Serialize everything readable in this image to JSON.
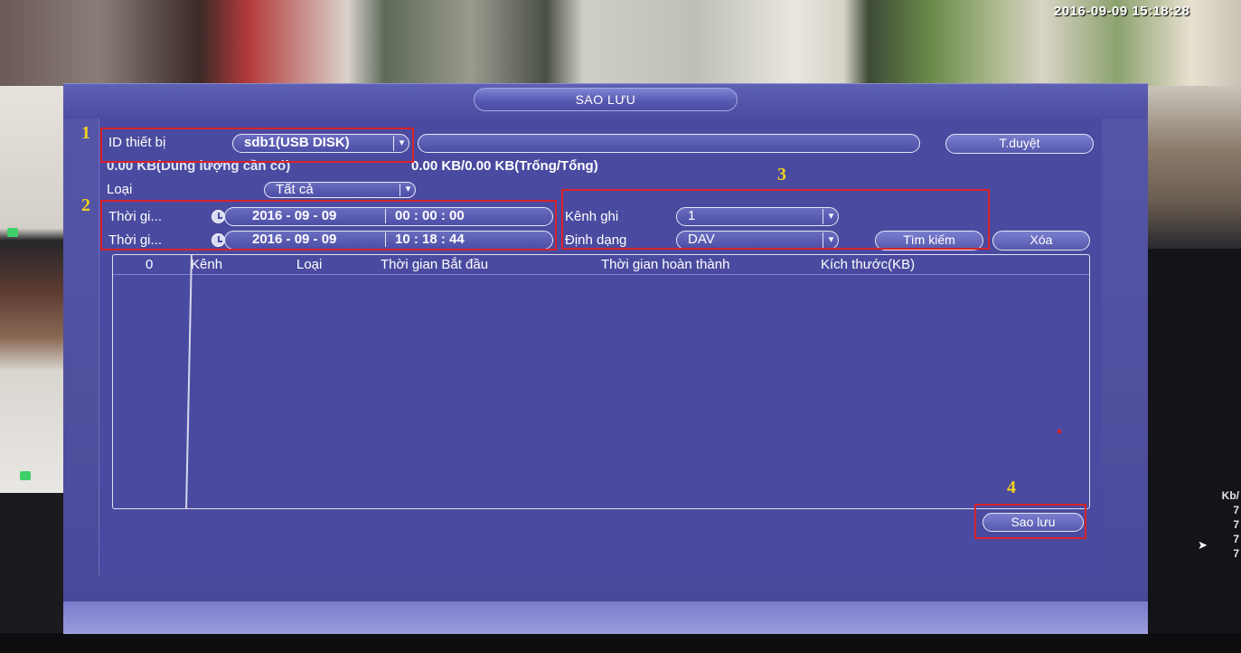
{
  "window": {
    "title": "SAO LƯU"
  },
  "overlay": {
    "timestamp": "2016-09-09 15:18:28",
    "side_unit": "Kb/",
    "side_values": [
      "7",
      "7",
      "7",
      "7"
    ]
  },
  "device": {
    "label": "ID thiết bị",
    "selected": "sdb1(USB DISK)",
    "path_value": "",
    "browse_button": "T.duyệt",
    "capacity_text": "0.00 KB(Dung lượng cần có)",
    "free_total_text": "0.00 KB/0.00 KB(Trống/Tổng)"
  },
  "filters": {
    "type_label": "Loại",
    "type_value": "Tất cả",
    "start_label": "Thời gi...",
    "start_date": "2016 - 09 - 09",
    "start_time": "00 : 00 : 00",
    "end_label": "Thời gi...",
    "end_date": "2016 - 09 - 09",
    "end_time": "10 : 18 : 44",
    "channel_label": "Kênh ghi",
    "channel_value": "1",
    "format_label": "Định dạng",
    "format_value": "DAV",
    "search_button": "Tìm kiếm",
    "clear_button": "Xóa"
  },
  "table": {
    "columns": [
      "0",
      "Kênh",
      "Loại",
      "Thời gian Bắt đầu",
      "Thời gian hoàn thành",
      "Kích thước(KB)"
    ],
    "rows": []
  },
  "actions": {
    "backup_button": "Sao lưu"
  },
  "annotations": {
    "labels": [
      "1",
      "2",
      "3",
      "4"
    ],
    "color": "#d8232a",
    "number_color": "#f2d21e"
  },
  "colors": {
    "dialog_bg": "#4f4f9e",
    "pill_border": "#e8e8f5"
  },
  "icons": {
    "clock": "clock-icon",
    "dropdown": "chevron-down-icon",
    "cursor": "mouse-pointer-icon"
  }
}
